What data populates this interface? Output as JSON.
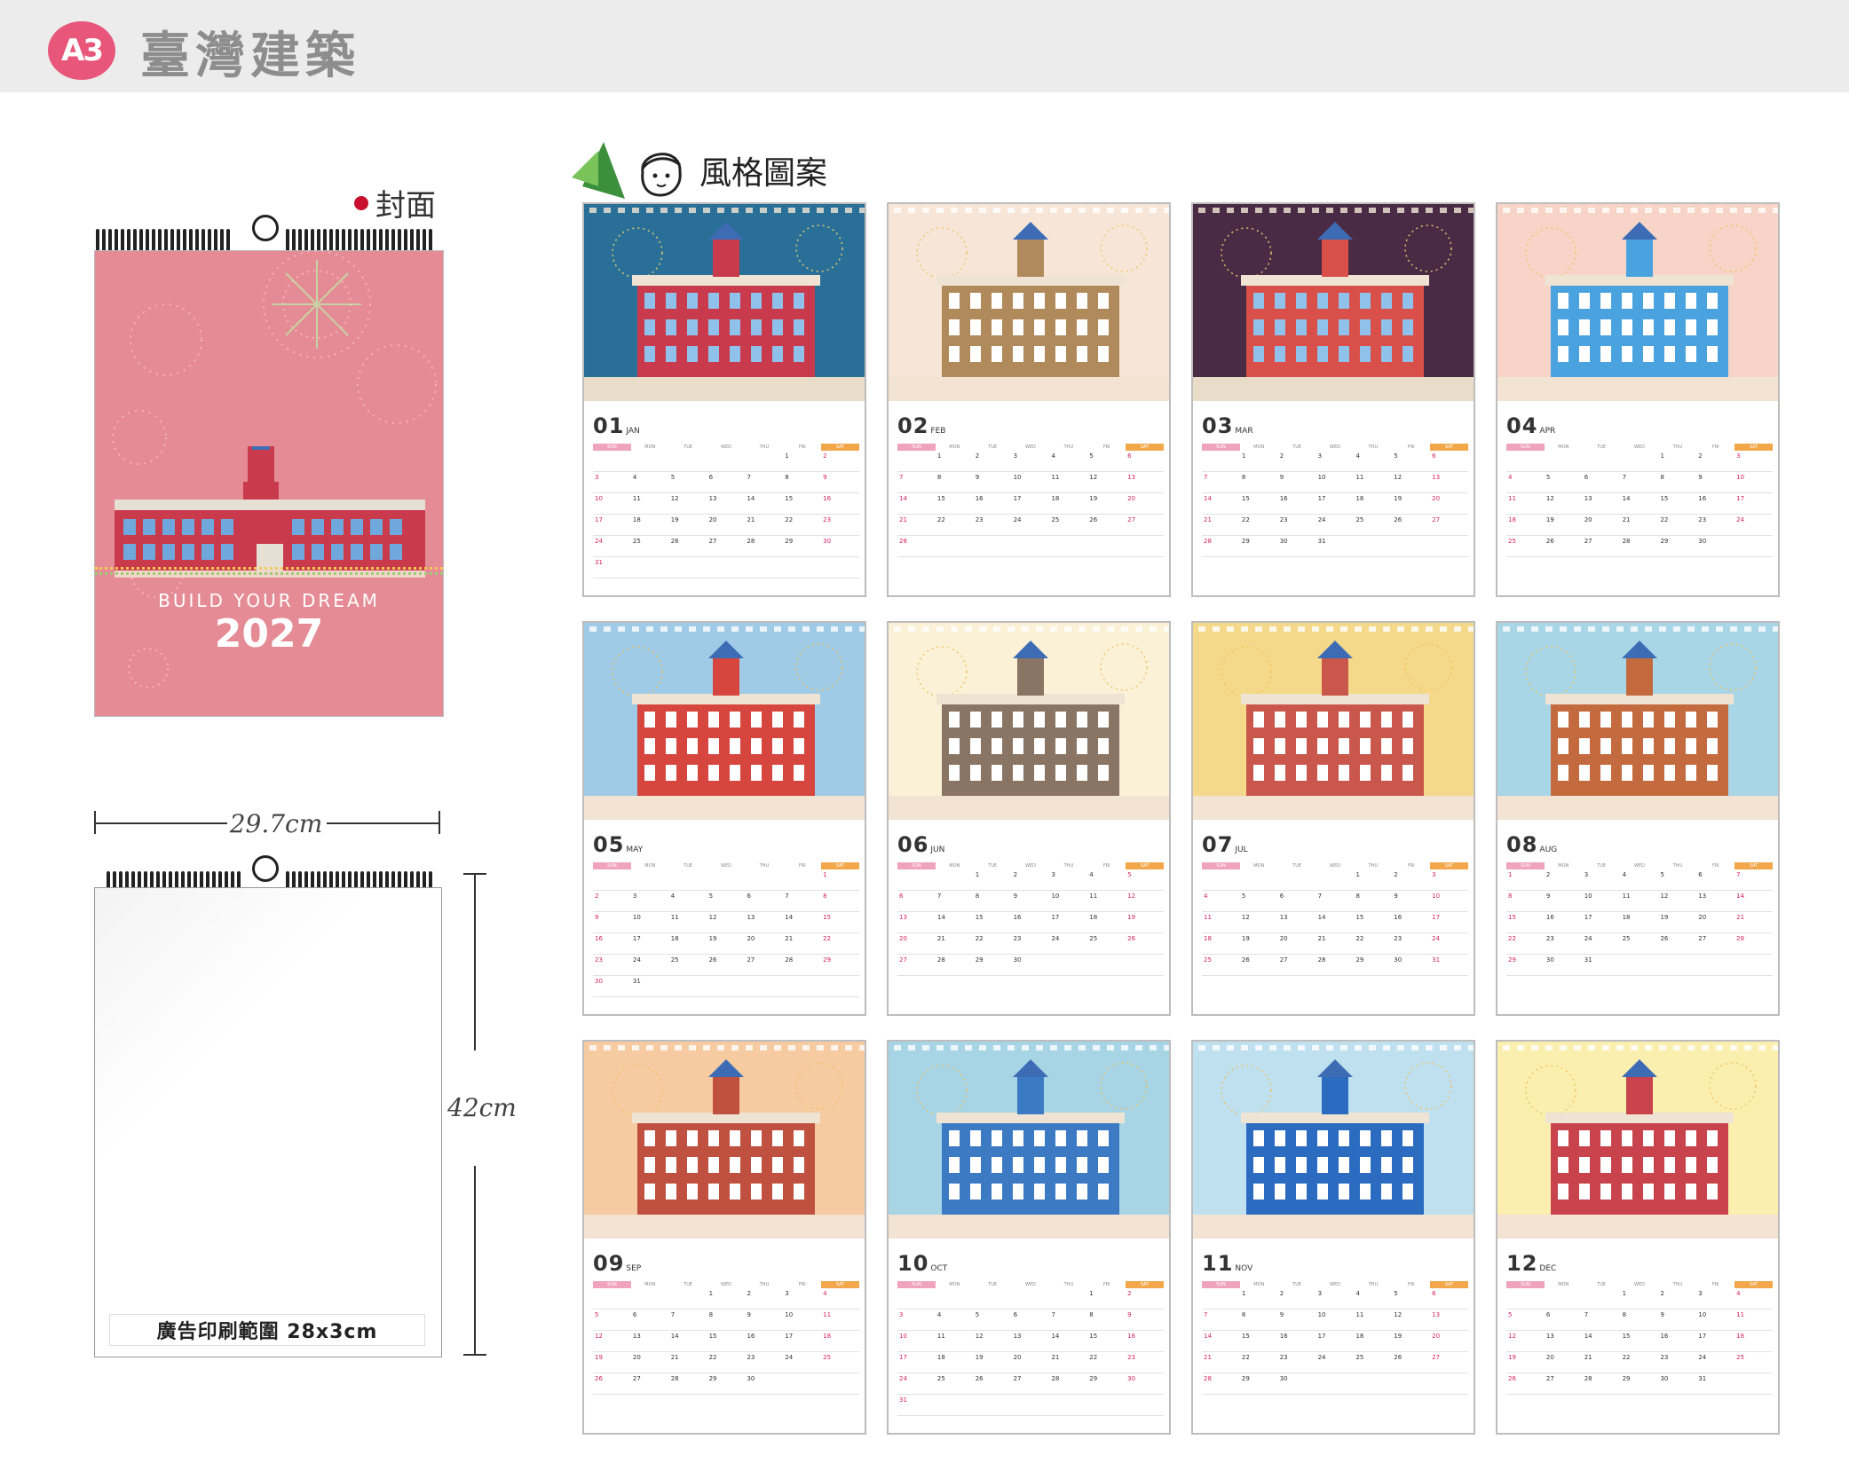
{
  "header": {
    "badge": "A3",
    "title": "臺灣建築"
  },
  "cover": {
    "tag": "封面",
    "subtitle": "BUILD YOUR DREAM",
    "year": "2027"
  },
  "dimensions": {
    "width": "29.7cm",
    "height": "42cm",
    "ad_area": "廣告印刷範圍 28x3cm"
  },
  "style_section": {
    "title": "風格圖案"
  },
  "weekday_labels": [
    "SUN",
    "MON",
    "TUE",
    "WED",
    "THU",
    "FRI",
    "SAT"
  ],
  "colors": {
    "badge": "#e8567a",
    "cover_bg": "#e58b95",
    "sunday": "#d6225c",
    "saturday_header": "#f1a74a",
    "sunday_header": "#f0a3bd"
  },
  "months": [
    {
      "num": "01",
      "abbr": "JAN",
      "theme": "#2a6f97",
      "accent": "#c93b4c"
    },
    {
      "num": "02",
      "abbr": "FEB",
      "theme": "#f7e6d8",
      "accent": "#b08a5a"
    },
    {
      "num": "03",
      "abbr": "MAR",
      "theme": "#4a2b46",
      "accent": "#d9504a"
    },
    {
      "num": "04",
      "abbr": "APR",
      "theme": "#f7d4c7",
      "accent": "#4aa3df"
    },
    {
      "num": "05",
      "abbr": "MAY",
      "theme": "#9fcbe6",
      "accent": "#d6463f"
    },
    {
      "num": "06",
      "abbr": "JUN",
      "theme": "#fbf1d6",
      "accent": "#8a7564"
    },
    {
      "num": "07",
      "abbr": "JUL",
      "theme": "#f5d98a",
      "accent": "#c9574b"
    },
    {
      "num": "08",
      "abbr": "AUG",
      "theme": "#a8d6e6",
      "accent": "#c46a3f"
    },
    {
      "num": "09",
      "abbr": "SEP",
      "theme": "#f6cba2",
      "accent": "#c0503f"
    },
    {
      "num": "10",
      "abbr": "OCT",
      "theme": "#a7d5e6",
      "accent": "#3d7ac4"
    },
    {
      "num": "11",
      "abbr": "NOV",
      "theme": "#bfe0ef",
      "accent": "#2c6cc0"
    },
    {
      "num": "12",
      "abbr": "DEC",
      "theme": "#fbefb0",
      "accent": "#c9434c"
    }
  ]
}
